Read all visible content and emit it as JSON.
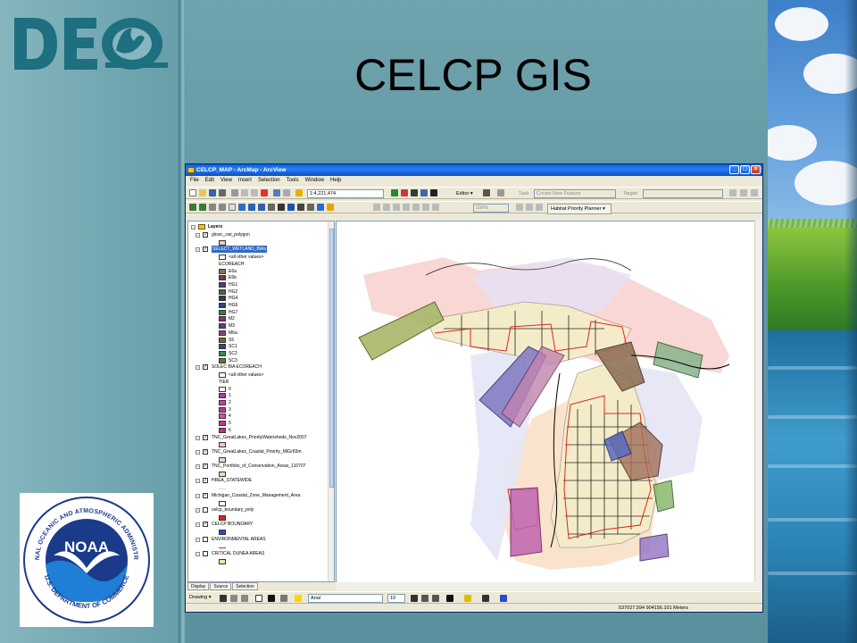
{
  "slide": {
    "title": "CELCP GIS",
    "deq_logo_text": "DEQ",
    "noaa_logo_text": "NOAA",
    "noaa_ring_top": "NATIONAL OCEANIC AND ATMOSPHERIC ADMINISTRATION",
    "noaa_ring_bottom": "U.S. DEPARTMENT OF COMMERCE"
  },
  "window": {
    "title": "CELCP_MAP - ArcMap - ArcView",
    "menu": [
      "File",
      "Edit",
      "View",
      "Insert",
      "Selection",
      "Tools",
      "Window",
      "Help"
    ],
    "scale": "1:4,221,474",
    "editor_label": "Editor ▾",
    "task_label": "Task:",
    "task_value": "Create New Feature",
    "target_label": "Target:",
    "zoom_value": "100%",
    "habitat_planner": "Habitat Priority Planner ▾",
    "drawing_label": "Drawing ▾",
    "font_name": "Arial",
    "font_size": "10",
    "status_coords": "537027.594  904156.101 Meters"
  },
  "toc": {
    "root": "Layers",
    "tabs": [
      "Display",
      "Source",
      "Selection"
    ],
    "layers": [
      {
        "name": "glcwc_cwi_polygon",
        "checked": true
      },
      {
        "name": "SELECT_WETLAND_BIAs",
        "checked": true,
        "selected": true
      },
      {
        "name": "<all other values>"
      },
      {
        "name": "ECOREACH"
      },
      {
        "name": "E6a"
      },
      {
        "name": "E6b"
      },
      {
        "name": "HG1"
      },
      {
        "name": "HG2"
      },
      {
        "name": "HG4"
      },
      {
        "name": "HG6"
      },
      {
        "name": "HG7"
      },
      {
        "name": "M2"
      },
      {
        "name": "M3"
      },
      {
        "name": "M6a"
      },
      {
        "name": "S5"
      },
      {
        "name": "SC1"
      },
      {
        "name": "SC2"
      },
      {
        "name": "SC3"
      },
      {
        "name": "SOLEC BIA ECOREACH",
        "checked": true
      },
      {
        "name": "<all other values>"
      },
      {
        "name": "TIER"
      },
      {
        "name": "0"
      },
      {
        "name": "1"
      },
      {
        "name": "2"
      },
      {
        "name": "3"
      },
      {
        "name": "4"
      },
      {
        "name": "5"
      },
      {
        "name": "6"
      },
      {
        "name": "TNC_GreatLakes_PriorityWatersheds_Nov2007",
        "checked": true
      },
      {
        "name": "TNC_GreatLakes_Coastal_Priority_MIGr83m",
        "checked": true
      },
      {
        "name": "TNC_Portfolio_of_Conservation_Areas_110707",
        "checked": true
      },
      {
        "name": "HREA_STATEWIDE",
        "checked": true
      },
      {
        "name": "Michigan_Coastal_Zone_Management_Area",
        "checked": true
      },
      {
        "name": "celcp_boundary_poly",
        "checked": false
      },
      {
        "name": "CELCP BOUNDARY",
        "checked": true
      },
      {
        "name": "ENVIRONMENTAL AREAS",
        "checked": false
      },
      {
        "name": "CRITICAL DUNEA AREAS",
        "checked": false
      }
    ],
    "colors": {
      "glcwc": "#f6c9c0",
      "ecoreach": [
        "#8a7a3a",
        "#7d2e6b",
        "#4b3f7f",
        "#3f6b4a",
        "#33355e",
        "#2f4a7a",
        "#3b7a3b",
        "#8a2f6f",
        "#5a3f8a",
        "#8a3f8a",
        "#6a6a2a",
        "#2a4a7a",
        "#3a8a5a",
        "#5a7a3a"
      ],
      "tier": [
        "#ffffff",
        "#b03aa0",
        "#d43aa8",
        "#c13a8c",
        "#e04aa6",
        "#c2388a",
        "#b23a8a"
      ],
      "accent": "#316ac5"
    }
  }
}
